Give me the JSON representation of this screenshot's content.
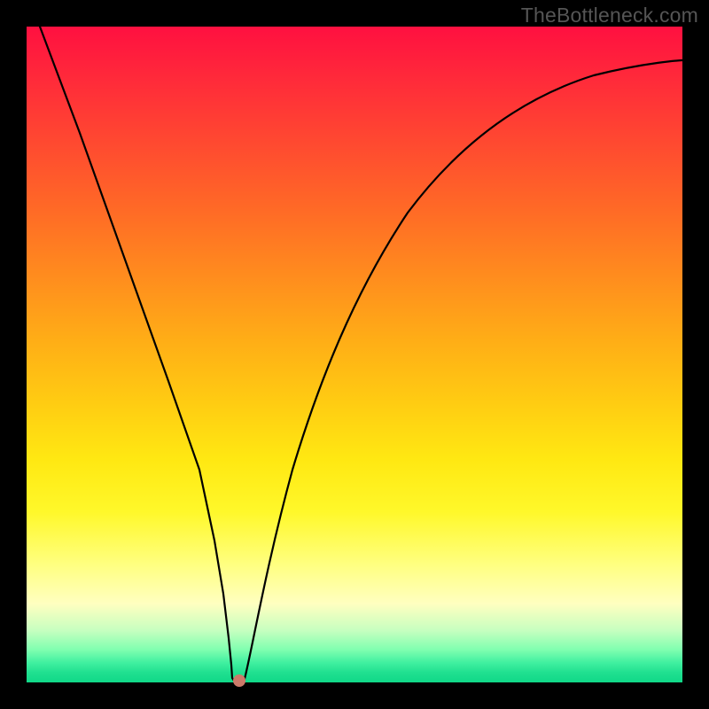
{
  "watermark": "TheBottleneck.com",
  "chart_data": {
    "type": "line",
    "title": "",
    "xlabel": "",
    "ylabel": "",
    "xlim": [
      0,
      1
    ],
    "ylim": [
      0,
      1
    ],
    "series": [
      {
        "name": "curve",
        "x": [
          0.02,
          0.05,
          0.1,
          0.15,
          0.2,
          0.24,
          0.27,
          0.29,
          0.3,
          0.31,
          0.32,
          0.34,
          0.37,
          0.41,
          0.46,
          0.52,
          0.6,
          0.7,
          0.8,
          0.9,
          1.0
        ],
        "values": [
          1.0,
          0.88,
          0.7,
          0.52,
          0.34,
          0.2,
          0.1,
          0.04,
          0.01,
          0.005,
          0.02,
          0.08,
          0.2,
          0.36,
          0.52,
          0.66,
          0.78,
          0.86,
          0.9,
          0.92,
          0.93
        ]
      }
    ],
    "marker": {
      "x": 0.305,
      "y": 0.0
    },
    "gradient_stops": [
      {
        "pos": 0.0,
        "color": "#ff1040"
      },
      {
        "pos": 0.5,
        "color": "#ffce12"
      },
      {
        "pos": 0.85,
        "color": "#ffffc0"
      },
      {
        "pos": 1.0,
        "color": "#10d888"
      }
    ]
  }
}
